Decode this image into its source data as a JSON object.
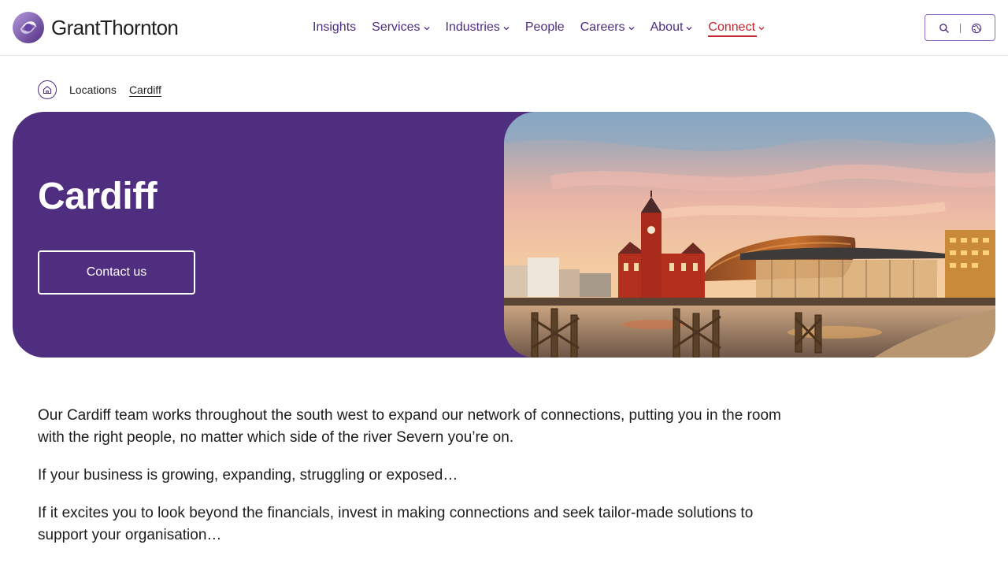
{
  "brand": {
    "name": "GrantThornton"
  },
  "nav": {
    "items": [
      {
        "label": "Insights",
        "has_dropdown": false
      },
      {
        "label": "Services",
        "has_dropdown": true
      },
      {
        "label": "Industries",
        "has_dropdown": true
      },
      {
        "label": "People",
        "has_dropdown": false
      },
      {
        "label": "Careers",
        "has_dropdown": true
      },
      {
        "label": "About",
        "has_dropdown": true
      },
      {
        "label": "Connect",
        "has_dropdown": true,
        "active": true
      }
    ]
  },
  "tools": {
    "search_icon": "search-icon",
    "globe_icon": "globe-icon"
  },
  "breadcrumb": {
    "home_icon": "home-icon",
    "items": [
      "Locations",
      "Cardiff"
    ]
  },
  "hero": {
    "title": "Cardiff",
    "cta_label": "Contact us"
  },
  "content": {
    "paragraphs": [
      "Our Cardiff team works throughout the south west to expand our network of connections, putting you in the room with the right people, no matter which side of the river Severn you’re on.",
      "If your business is growing, expanding, struggling or exposed…",
      "If it excites you to look beyond the financials, invest in making connections and seek tailor-made solutions to support your organisation…"
    ]
  },
  "colors": {
    "brand_purple": "#4f2d7f",
    "accent_red": "#c2262e",
    "text": "#1c1c1c",
    "tool_border": "#8d6bc4"
  }
}
